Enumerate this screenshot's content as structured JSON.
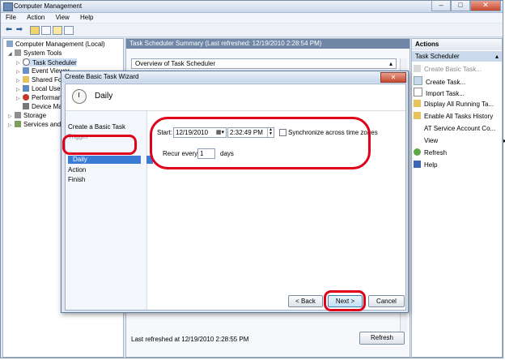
{
  "window": {
    "title": "Computer Management"
  },
  "menu": [
    "File",
    "Action",
    "View",
    "Help"
  ],
  "tree": {
    "root": "Computer Management (Local)",
    "items": [
      "System Tools",
      "Task Scheduler",
      "Event Viewer",
      "Shared Fol",
      "Local Users",
      "Performance",
      "Device Ma",
      "Storage",
      "Services and A"
    ]
  },
  "center": {
    "header": "Task Scheduler Summary (Last refreshed: 12/19/2010 2:28:54 PM)",
    "overview": "Overview of Task Scheduler",
    "last_refreshed": "Last refreshed at 12/19/2010 2:28:55 PM",
    "refresh_label": "Refresh"
  },
  "actions": {
    "title": "Actions",
    "sub": "Task Scheduler",
    "items": [
      "Create Basic Task...",
      "Create Task...",
      "Import Task...",
      "Display All Running Ta...",
      "Enable All Tasks History",
      "AT Service Account Co...",
      "View",
      "Refresh",
      "Help"
    ]
  },
  "wizard": {
    "title": "Create Basic Task Wizard",
    "heading": "Daily",
    "steps": [
      "Create a Basic Task",
      "Trigger",
      "Daily",
      "Action",
      "Finish"
    ],
    "start_label": "Start:",
    "start_date": "12/19/2010",
    "start_time": "2:32:49 PM",
    "sync_label": "Synchronize across time zones",
    "recur_label": "Recur every:",
    "recur_value": "1",
    "recur_unit": "days",
    "back_label": "< Back",
    "next_label": "Next >",
    "cancel_label": "Cancel"
  },
  "colors": {
    "highlight": "#e0001a",
    "selection": "#3a7bd5"
  }
}
